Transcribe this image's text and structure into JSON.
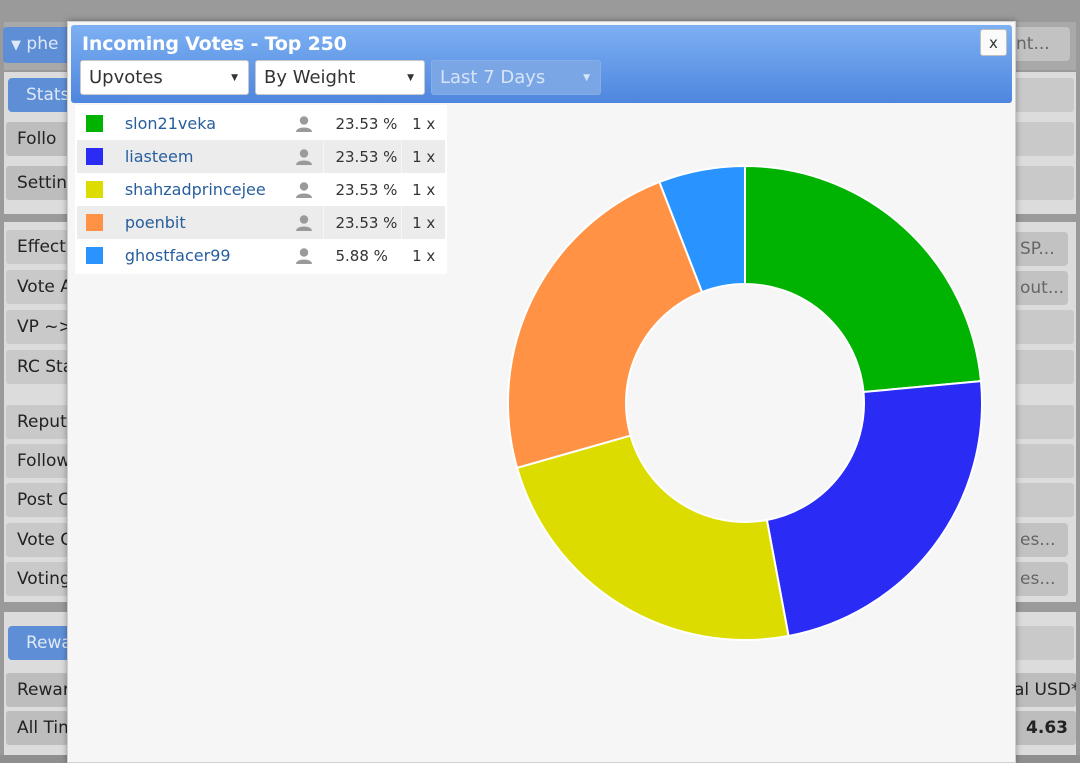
{
  "background": {
    "user_toggle": "phe",
    "stats_tab": "Stats",
    "follow_item": "Follo",
    "settings_item": "Settin",
    "right_button_1": "nt...",
    "rows": [
      "Effecti",
      "Vote A",
      "VP ~>",
      "RC Sta",
      "Reput",
      "Follow",
      "Post C",
      "Vote C",
      "Voting"
    ],
    "right_sp": "SP...",
    "right_out": "out...",
    "right_es1": "es...",
    "right_es2": "es...",
    "rewards_tab": "Rewa",
    "reward_row": "Rewar",
    "reward_right": "al USD*",
    "alltime_row": "All Tim",
    "alltime_value": "4.63"
  },
  "modal": {
    "title": "Incoming Votes - Top 250",
    "close_label": "x",
    "selects": {
      "type": "Upvotes",
      "order": "By Weight",
      "period": "Last 7 Days"
    }
  },
  "legend": [
    {
      "name": "slon21veka",
      "percent": "23.53 %",
      "count": "1 x",
      "color": "#00b300"
    },
    {
      "name": "liasteem",
      "percent": "23.53 %",
      "count": "1 x",
      "color": "#2a2cf5"
    },
    {
      "name": "shahzadprincejee",
      "percent": "23.53 %",
      "count": "1 x",
      "color": "#dcdc00"
    },
    {
      "name": "poenbit",
      "percent": "23.53 %",
      "count": "1 x",
      "color": "#ff9245"
    },
    {
      "name": "ghostfacer99",
      "percent": "5.88 %",
      "count": "1 x",
      "color": "#2994ff"
    }
  ],
  "chart_data": {
    "type": "pie",
    "donut": true,
    "categories": [
      "slon21veka",
      "liasteem",
      "shahzadprincejee",
      "poenbit",
      "ghostfacer99"
    ],
    "values": [
      23.53,
      23.53,
      23.53,
      23.53,
      5.88
    ],
    "colors": [
      "#00b300",
      "#2a2cf5",
      "#dcdc00",
      "#ff9245",
      "#2994ff"
    ]
  }
}
